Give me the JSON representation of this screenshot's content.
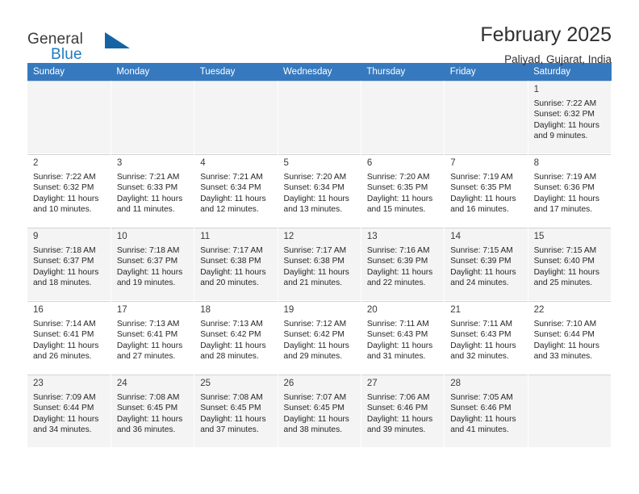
{
  "brand": {
    "name_part1": "General",
    "name_part2": "Blue",
    "logo_icon": "triangle-flag-icon"
  },
  "header": {
    "title": "February 2025",
    "location": "Paliyad, Gujarat, India"
  },
  "calendar": {
    "weekday_headers": [
      "Sunday",
      "Monday",
      "Tuesday",
      "Wednesday",
      "Thursday",
      "Friday",
      "Saturday"
    ],
    "accent_color": "#3679bf",
    "shade_color": "#f4f4f4",
    "weeks": [
      [
        {
          "empty": true
        },
        {
          "empty": true
        },
        {
          "empty": true
        },
        {
          "empty": true
        },
        {
          "empty": true
        },
        {
          "empty": true
        },
        {
          "day": "1",
          "sunrise": "Sunrise: 7:22 AM",
          "sunset": "Sunset: 6:32 PM",
          "daylight": "Daylight: 11 hours and 9 minutes."
        }
      ],
      [
        {
          "day": "2",
          "sunrise": "Sunrise: 7:22 AM",
          "sunset": "Sunset: 6:32 PM",
          "daylight": "Daylight: 11 hours and 10 minutes."
        },
        {
          "day": "3",
          "sunrise": "Sunrise: 7:21 AM",
          "sunset": "Sunset: 6:33 PM",
          "daylight": "Daylight: 11 hours and 11 minutes."
        },
        {
          "day": "4",
          "sunrise": "Sunrise: 7:21 AM",
          "sunset": "Sunset: 6:34 PM",
          "daylight": "Daylight: 11 hours and 12 minutes."
        },
        {
          "day": "5",
          "sunrise": "Sunrise: 7:20 AM",
          "sunset": "Sunset: 6:34 PM",
          "daylight": "Daylight: 11 hours and 13 minutes."
        },
        {
          "day": "6",
          "sunrise": "Sunrise: 7:20 AM",
          "sunset": "Sunset: 6:35 PM",
          "daylight": "Daylight: 11 hours and 15 minutes."
        },
        {
          "day": "7",
          "sunrise": "Sunrise: 7:19 AM",
          "sunset": "Sunset: 6:35 PM",
          "daylight": "Daylight: 11 hours and 16 minutes."
        },
        {
          "day": "8",
          "sunrise": "Sunrise: 7:19 AM",
          "sunset": "Sunset: 6:36 PM",
          "daylight": "Daylight: 11 hours and 17 minutes."
        }
      ],
      [
        {
          "day": "9",
          "sunrise": "Sunrise: 7:18 AM",
          "sunset": "Sunset: 6:37 PM",
          "daylight": "Daylight: 11 hours and 18 minutes."
        },
        {
          "day": "10",
          "sunrise": "Sunrise: 7:18 AM",
          "sunset": "Sunset: 6:37 PM",
          "daylight": "Daylight: 11 hours and 19 minutes."
        },
        {
          "day": "11",
          "sunrise": "Sunrise: 7:17 AM",
          "sunset": "Sunset: 6:38 PM",
          "daylight": "Daylight: 11 hours and 20 minutes."
        },
        {
          "day": "12",
          "sunrise": "Sunrise: 7:17 AM",
          "sunset": "Sunset: 6:38 PM",
          "daylight": "Daylight: 11 hours and 21 minutes."
        },
        {
          "day": "13",
          "sunrise": "Sunrise: 7:16 AM",
          "sunset": "Sunset: 6:39 PM",
          "daylight": "Daylight: 11 hours and 22 minutes."
        },
        {
          "day": "14",
          "sunrise": "Sunrise: 7:15 AM",
          "sunset": "Sunset: 6:39 PM",
          "daylight": "Daylight: 11 hours and 24 minutes."
        },
        {
          "day": "15",
          "sunrise": "Sunrise: 7:15 AM",
          "sunset": "Sunset: 6:40 PM",
          "daylight": "Daylight: 11 hours and 25 minutes."
        }
      ],
      [
        {
          "day": "16",
          "sunrise": "Sunrise: 7:14 AM",
          "sunset": "Sunset: 6:41 PM",
          "daylight": "Daylight: 11 hours and 26 minutes."
        },
        {
          "day": "17",
          "sunrise": "Sunrise: 7:13 AM",
          "sunset": "Sunset: 6:41 PM",
          "daylight": "Daylight: 11 hours and 27 minutes."
        },
        {
          "day": "18",
          "sunrise": "Sunrise: 7:13 AM",
          "sunset": "Sunset: 6:42 PM",
          "daylight": "Daylight: 11 hours and 28 minutes."
        },
        {
          "day": "19",
          "sunrise": "Sunrise: 7:12 AM",
          "sunset": "Sunset: 6:42 PM",
          "daylight": "Daylight: 11 hours and 29 minutes."
        },
        {
          "day": "20",
          "sunrise": "Sunrise: 7:11 AM",
          "sunset": "Sunset: 6:43 PM",
          "daylight": "Daylight: 11 hours and 31 minutes."
        },
        {
          "day": "21",
          "sunrise": "Sunrise: 7:11 AM",
          "sunset": "Sunset: 6:43 PM",
          "daylight": "Daylight: 11 hours and 32 minutes."
        },
        {
          "day": "22",
          "sunrise": "Sunrise: 7:10 AM",
          "sunset": "Sunset: 6:44 PM",
          "daylight": "Daylight: 11 hours and 33 minutes."
        }
      ],
      [
        {
          "day": "23",
          "sunrise": "Sunrise: 7:09 AM",
          "sunset": "Sunset: 6:44 PM",
          "daylight": "Daylight: 11 hours and 34 minutes."
        },
        {
          "day": "24",
          "sunrise": "Sunrise: 7:08 AM",
          "sunset": "Sunset: 6:45 PM",
          "daylight": "Daylight: 11 hours and 36 minutes."
        },
        {
          "day": "25",
          "sunrise": "Sunrise: 7:08 AM",
          "sunset": "Sunset: 6:45 PM",
          "daylight": "Daylight: 11 hours and 37 minutes."
        },
        {
          "day": "26",
          "sunrise": "Sunrise: 7:07 AM",
          "sunset": "Sunset: 6:45 PM",
          "daylight": "Daylight: 11 hours and 38 minutes."
        },
        {
          "day": "27",
          "sunrise": "Sunrise: 7:06 AM",
          "sunset": "Sunset: 6:46 PM",
          "daylight": "Daylight: 11 hours and 39 minutes."
        },
        {
          "day": "28",
          "sunrise": "Sunrise: 7:05 AM",
          "sunset": "Sunset: 6:46 PM",
          "daylight": "Daylight: 11 hours and 41 minutes."
        },
        {
          "empty": true
        }
      ]
    ]
  }
}
